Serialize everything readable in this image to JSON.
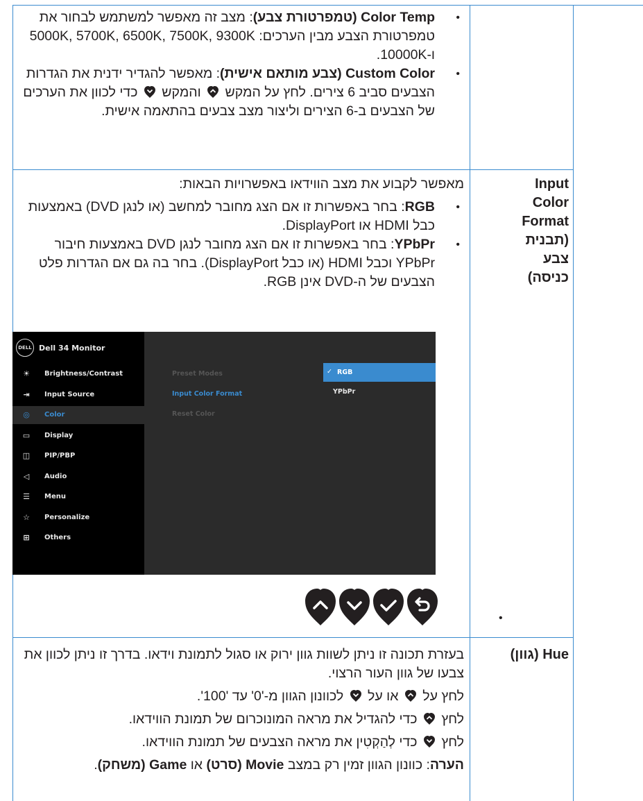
{
  "row1": {
    "bullet1_term": "Color Temp (טמפרטורת צבע)",
    "bullet1_text": ": מצב זה מאפשר למשתמש לבחור את טמפרטורת הצבע מבין הערכים: 5000K, 5700K, 6500K, 7500K, 9300K ו-10000K.",
    "bullet2_term": "Custom Color (צבע מותאם אישית)",
    "bullet2_text_a": ": מאפשר להגדיר ידנית את הגדרות הצבעים סביב 6 צירים. לחץ על המקש",
    "bullet2_text_b": "והמקש",
    "bullet2_text_c": "כדי לכוון את הערכים של הצבעים ב-6 הצירים וליצור מצב צבעים בהתאמה אישית."
  },
  "row2": {
    "label": "Input Color Format (תבנית צבע כניסה)",
    "intro": "מאפשר לקבוע את מצב הווידאו באפשרויות הבאות:",
    "bullet1_term": "RGB",
    "bullet1_text": ": בחר באפשרות זו אם הצג מחובר למחשב (או לנגן DVD) באמצעות כבל HDMI או DisplayPort.",
    "bullet2_term": "YPbPr",
    "bullet2_text": ": בחר באפשרות זו אם הצג מחובר לנגן DVD באמצעות חיבור YPbPr וכבל HDMI (או כבל DisplayPort). בחר בה גם אם הגדרות פלט הצבעים של ה-DVD אינן RGB.",
    "lone_bullet": "•"
  },
  "osd": {
    "logo": "DELL",
    "title": "Dell 34 Monitor",
    "menu": [
      {
        "icon": "brightness-icon",
        "glyph": "☀",
        "label": "Brightness/Contrast",
        "active": false
      },
      {
        "icon": "input-source-icon",
        "glyph": "⇥",
        "label": "Input Source",
        "active": false
      },
      {
        "icon": "color-palette-icon",
        "glyph": "◎",
        "label": "Color",
        "active": true
      },
      {
        "icon": "display-icon",
        "glyph": "▭",
        "label": "Display",
        "active": false
      },
      {
        "icon": "pip-pbp-icon",
        "glyph": "◫",
        "label": "PIP/PBP",
        "active": false
      },
      {
        "icon": "audio-icon",
        "glyph": "◁",
        "label": "Audio",
        "active": false
      },
      {
        "icon": "menu-icon",
        "glyph": "☰",
        "label": "Menu",
        "active": false
      },
      {
        "icon": "star-icon",
        "glyph": "☆",
        "label": "Personalize",
        "active": false
      },
      {
        "icon": "others-icon",
        "glyph": "⊞",
        "label": "Others",
        "active": false
      }
    ],
    "submenu": [
      "Preset Modes",
      "Input Color Format",
      "Reset Color"
    ],
    "options": [
      "RGB",
      "YPbPr"
    ],
    "check": "✓"
  },
  "row3": {
    "label": "Hue (גוון)",
    "p1": "בעזרת תכונה זו ניתן לשוות גוון ירוק או סגול לתמונת וידאו. בדרך זו ניתן לכוון את צבעו של גוון העור הרצוי.",
    "p2_a": "לחץ על",
    "p2_b": "או על",
    "p2_c": "לכוונון הגוון מ-'0' עד '100'.",
    "p3_a": "לחץ",
    "p3_b": "כדי להגדיל את מראה המונוכרום של תמונת הווידאו.",
    "p4_a": "לחץ",
    "p4_b": "כדי לְהַקְטִין את מראה הצבעים של תמונת הווידאו.",
    "note_term": "הערה",
    "note_a": ": כוונון הגוון זמין רק במצב",
    "note_movie": "Movie (סרט)",
    "note_or": "או",
    "note_game": "Game (משחק)",
    "note_end": "."
  },
  "colors": {
    "border": "#3a8bcf",
    "osd_accent": "#3a8bcf",
    "text": "#231f20"
  }
}
